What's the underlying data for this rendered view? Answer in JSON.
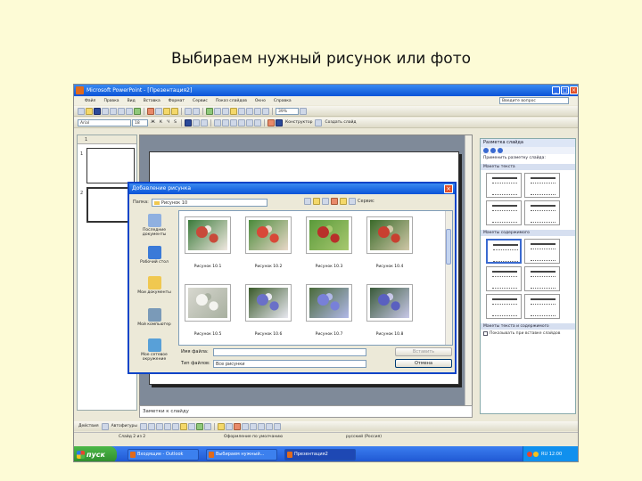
{
  "slide_title": "Выбираем нужный рисунок или фото",
  "window": {
    "title": "Microsoft PowerPoint - [Презентация2]",
    "help_placeholder": "Введите вопрос"
  },
  "menu": [
    "Файл",
    "Правка",
    "Вид",
    "Вставка",
    "Формат",
    "Сервис",
    "Показ слайдов",
    "Окно",
    "Справка"
  ],
  "toolbar": {
    "font_name": "Arial",
    "font_size": "18",
    "zoom": "39%",
    "designer_label": "Конструктор",
    "new_slide_label": "Создать слайд"
  },
  "left_pane": {
    "tab_label": "1",
    "slide_numbers": [
      "1",
      "2"
    ]
  },
  "notes_text": "Заметки к слайду",
  "task_pane": {
    "title": "Разметка слайда",
    "apply_label": "Применить разметку слайда:",
    "section_text": "Макеты текста",
    "section_content": "Макеты содержимого",
    "section_text_content": "Макеты текста и содержимого",
    "checkbox_label": "Показывать при вставке слайдов"
  },
  "dialog": {
    "title": "Добавление рисунка",
    "folder_label": "Папка:",
    "folder_value": "Рисунок 10",
    "service_label": "Сервис",
    "places": [
      "Последние документы",
      "Рабочий стол",
      "Мои документы",
      "Мой компьютер",
      "Мое сетевое окружение"
    ],
    "photos": [
      {
        "caption": "Рисунок 10.1",
        "palette": [
          "#c84a3a",
          "#3a7a3a",
          "#f0e8e0"
        ]
      },
      {
        "caption": "Рисунок 10.2",
        "palette": [
          "#d84838",
          "#4a8a3a",
          "#e8d8c8"
        ]
      },
      {
        "caption": "Рисунок 10.3",
        "palette": [
          "#b8302a",
          "#5a9a3a",
          "#a8c870"
        ]
      },
      {
        "caption": "Рисунок 10.4",
        "palette": [
          "#c84030",
          "#3a6a2a",
          "#d0c8a8"
        ]
      },
      {
        "caption": "Рисунок 10.5",
        "palette": [
          "#f4f4f0",
          "#d8d8d0",
          "#a8b0a0"
        ]
      },
      {
        "caption": "Рисунок 10.6",
        "palette": [
          "#6a70c8",
          "#3a5a2a",
          "#e8e8f0"
        ]
      },
      {
        "caption": "Рисунок 10.7",
        "palette": [
          "#7880d8",
          "#4a6a3a",
          "#b0b8e8"
        ]
      },
      {
        "caption": "Рисунок 10.8",
        "palette": [
          "#5a60c0",
          "#3a5a3a",
          "#c8c8e8"
        ]
      }
    ],
    "file_name_label": "Имя файла:",
    "file_type_label": "Тип файлов:",
    "file_type_value": "Все рисунки",
    "insert_button": "Вставить",
    "cancel_button": "Отмена"
  },
  "draw_toolbar": {
    "actions_label": "Действия",
    "autoshapes_label": "Автофигуры"
  },
  "statusbar": {
    "slide_info": "Слайд 2 из 2",
    "design": "Оформление по умолчанию",
    "language": "русский (Россия)"
  },
  "taskbar": {
    "start_label": "пуск",
    "tasks": [
      "Входящие - Outlook",
      "Выбираем нужный...",
      "Презентация2"
    ],
    "language": "RU",
    "time": "12:00"
  }
}
